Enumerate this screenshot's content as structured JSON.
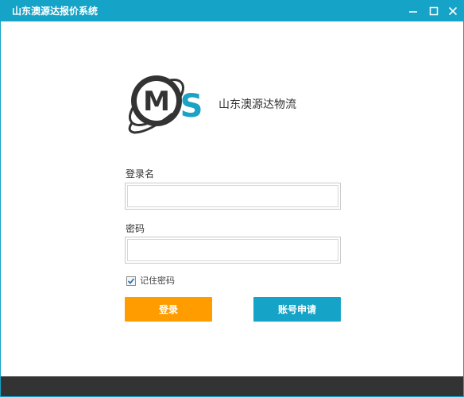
{
  "window": {
    "title": "山东澳源达报价系统"
  },
  "titlebar_controls": [
    "minimize-icon",
    "maximize-icon",
    "close-icon"
  ],
  "logo": {
    "letters": "MS"
  },
  "brand": {
    "name": "山东澳源达物流"
  },
  "form": {
    "username_label": "登录名",
    "username_value": "",
    "password_label": "密码",
    "password_value": "",
    "remember_label": "记住密码",
    "remember_checked": true,
    "login_button": "登录",
    "apply_button": "账号申请"
  },
  "colors": {
    "titlebar": "#15a3c7",
    "login_button": "#ff9d00",
    "apply_button": "#15a3c7",
    "footer": "#333333",
    "logo_s": "#1aa3c4"
  }
}
